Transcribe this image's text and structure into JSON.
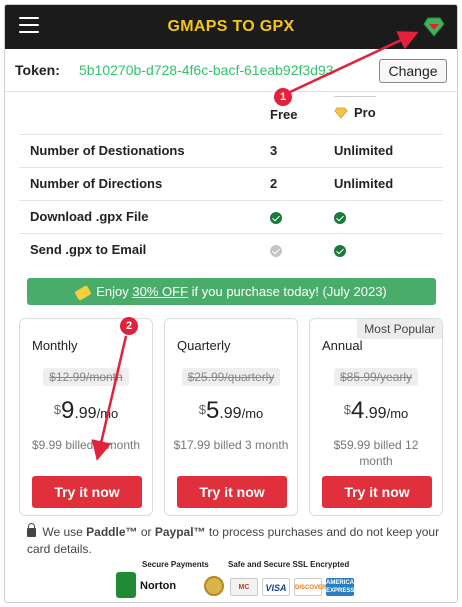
{
  "header": {
    "title": "GMAPS TO GPX",
    "menu_icon": "hamburger-icon",
    "pro_icon": "pro-diamond-icon"
  },
  "token": {
    "label": "Token:",
    "value": "5b10270b-d728-4f6c-bacf-61eab92f3d93",
    "change_label": "Change"
  },
  "features": {
    "free_header": "Free",
    "pro_header": "Pro",
    "rows": [
      {
        "name": "Number of Destionations",
        "free": "3",
        "pro": "Unlimited"
      },
      {
        "name": "Number of Directions",
        "free": "2",
        "pro": "Unlimited"
      },
      {
        "name": "Download .gpx File",
        "free_icon": "check-icon",
        "pro_icon": "check-icon"
      },
      {
        "name": "Send .gpx to Email",
        "free_icon": "check-disabled-icon",
        "pro_icon": "check-icon"
      }
    ]
  },
  "promo": {
    "prefix": "Enjoy",
    "highlight": "30% OFF",
    "suffix": "if you purchase today!  (July 2023)"
  },
  "plans": [
    {
      "name": "Monthly",
      "old_price": "$12.99/month",
      "currency": "$",
      "whole": "9",
      "cents": ".99",
      "per": "/mo",
      "billed": "$9.99 billed 1 month",
      "cta": "Try it now"
    },
    {
      "name": "Quarterly",
      "old_price": "$25.99/quarterly",
      "currency": "$",
      "whole": "5",
      "cents": ".99",
      "per": "/mo",
      "billed": "$17.99 billed 3 month",
      "cta": "Try it now"
    },
    {
      "name": "Annual",
      "old_price": "$85.99/yearly",
      "currency": "$",
      "whole": "4",
      "cents": ".99",
      "per": "/mo",
      "billed": "$59.99 billed 12 month",
      "cta": "Try it now",
      "badge": "Most Popular"
    }
  ],
  "note": {
    "pre": "We use",
    "brand1": "Paddle™",
    "mid": "or",
    "brand2": "Paypal™",
    "post": "to process purchases and do not keep your card details."
  },
  "trust": {
    "secure_payments": "Secure Payments",
    "ssl": "Safe and Secure SSL Encrypted",
    "norton": "Norton",
    "visa": "VISA",
    "discover": "DISCOVER",
    "amex": "AMERICAN EXPRESS"
  },
  "annotations": {
    "marker1": "1",
    "marker2": "2",
    "color": "#e3213a"
  },
  "colors": {
    "topbar": "#1b1b1b",
    "title": "#f5c518",
    "token_value": "#33c26b",
    "unlimited": "#b81c1c",
    "promo_bg": "#4aac6a",
    "cta_bg": "#e0303b"
  }
}
